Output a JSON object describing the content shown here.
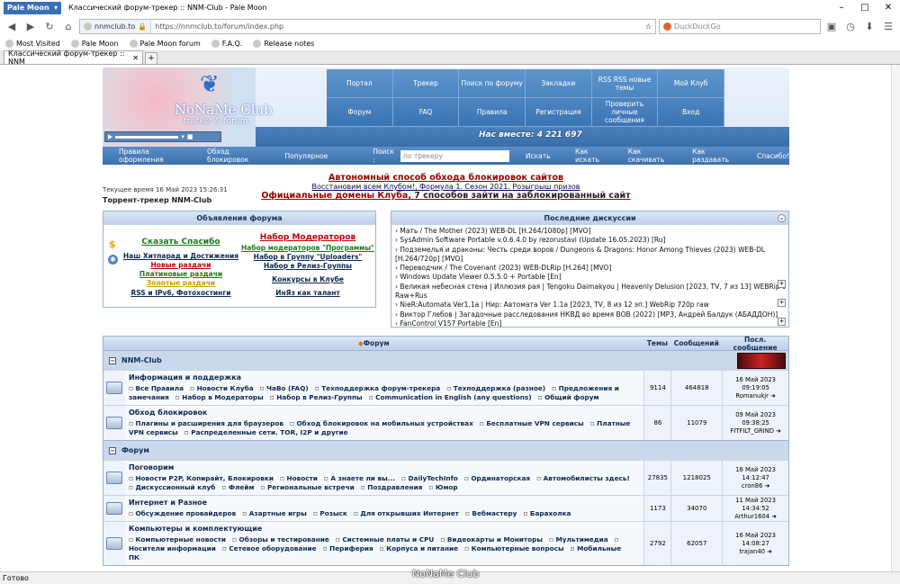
{
  "browser": {
    "app_button": "Pale Moon",
    "window_title": "Классический форум-трекер :: NNM-Club - Pale Moon",
    "url_host": "nnmclub.to",
    "url_full": "https://nnmclub.to/forum/index.php",
    "search_placeholder": "DuckDuckGo",
    "bookmarks": [
      "Most Visited",
      "Pale Moon",
      "Pale Moon forum",
      "F.A.Q.",
      "Release notes"
    ],
    "tab_title": "Классический форум-трекер :: NNM",
    "status": "Готово"
  },
  "header": {
    "logo_text": "NoNaMe Club",
    "logo_sub": "tracker & forum",
    "menu": [
      "Портал",
      "Трекер",
      "Поиск по форуму",
      "Закладки",
      "RSS RSS новые темы",
      "Мой Клуб",
      "Форум",
      "FAQ",
      "Правила",
      "Регистрация",
      "Проверить личные сообщения",
      "Вход"
    ],
    "online": "Нас вместе: 4 221 697",
    "subnav": [
      "Правила оформления",
      "Обход блокировок",
      "Популярное"
    ],
    "search_label": "Поиск :",
    "search_placeholder": "по трекеру",
    "search_button": "Искать",
    "subnav_right": [
      "Как искать",
      "Как скачивать",
      "Как раздавать",
      "Спасибо!"
    ]
  },
  "announcements": {
    "line1": "Автономный способ обхода блокировок сайтов",
    "line2a": "Восстановим всем Клубом!",
    "line2b": "Формула 1. Сезон 2021. Розыгрыш призов",
    "line3a": "Официальные домены Клуба",
    "line3b": "7 способов зайти на заблокированный сайт",
    "current_time": "Текущее время 16 Май 2023 15:26:31",
    "tracker_label": "Торрент-трекер NNM-Club"
  },
  "forum_ann": {
    "title": "Объявления форума",
    "col1": [
      {
        "text": "Сказать Спасибо",
        "color": "#1a7a1a"
      },
      {
        "text": "Наш Хитпарад и Достижения",
        "color": "#0d2750"
      },
      {
        "text": "Новые раздачи",
        "color": "#c00000"
      },
      {
        "text": "Платиновые раздачи",
        "color": "#1a7a1a"
      },
      {
        "text": "Золотые раздачи",
        "color": "#c99a00"
      },
      {
        "text": "RSS и IPv6, Фотохостинги",
        "color": "#0d2750"
      }
    ],
    "col2": [
      {
        "text": "Набор Модераторов",
        "color": "#c00000"
      },
      {
        "text": "Набор модераторов \"Программы\"",
        "color": "#1a7a1a"
      },
      {
        "text": "Набор в Группу \"Uploaders\"",
        "color": "#0d2750"
      },
      {
        "text": "Набор в Релиз-Группы",
        "color": "#0d2750"
      },
      {
        "text": "Конкурсы в Клубе",
        "color": "#0d2750"
      },
      {
        "text": "ИнЯз как талант",
        "color": "#0d2750"
      }
    ]
  },
  "discussions": {
    "title": "Последние дискуссии",
    "items": [
      "Мать / The Mother (2023) WEB-DL [H.264/1080p] [MVO]",
      "SysAdmin Software Portable v.0.6.4.0 by rezorustavi (Update 16.05.2023) [Ru]",
      "Подземелья и драконы: Честь среди воров / Dungeons & Dragons: Honor Among Thieves (2023) WEB-DL",
      "[H.264/720p] [MVO]",
      "Переводчик / The Covenant (2023) WEB-DLRip [H.264] [MVO]",
      "Windows Update Viewer 0.5.5.0 + Portable [En]",
      "Великая небесная стена | Иллюзия рая | Tengoku Daimakyou | Heavenly Delusion [2023, TV, 7 из 13] WEBRip 1080p",
      "Raw+Rus",
      "NieR:Automata Ver1.1a | Нир: Автомата Ver 1.1a [2023, TV, 8 из 12 эп.] WebRip 720p raw",
      "Виктор Глебов | Загадочные расследования НКВД во время ВОВ (2022) [MP3, Андрей Балдук (АБАДДОН)]",
      "FanControl V157 Portable [En]"
    ]
  },
  "table": {
    "head": [
      "Форум",
      "Темы",
      "Сообщений",
      "Посл. сообщение"
    ],
    "categories": [
      {
        "name": "NNM-Club",
        "forums": [
          {
            "name": "Информация и поддержка",
            "subs": "Все Правила|Новости Клуба|ЧаВо (FAQ)|Техподдержка форум-трекера|Техподдержка (разное)|Предложения и замечания|Набор в Модераторы|Набор в Релиз-Группы|Communication in English (any questions)|Общий форум",
            "topics": "9114",
            "posts": "464818",
            "last_date": "16 Май 2023 09:19:05",
            "last_user": "Romanukjr"
          },
          {
            "name": "Обход блокировок",
            "subs": "Плагины и расширения для браузеров|Обход блокировок на мобильных устройствах|Бесплатные VPN сервисы|Платные VPN сервисы|Распределенные сети. TOR, I2P и другие",
            "topics": "86",
            "posts": "11079",
            "last_date": "09 Май 2023 09:38:25",
            "last_user": "FITFILT_GRIND"
          }
        ]
      },
      {
        "name": "Форум",
        "forums": [
          {
            "name": "Поговорим",
            "subs": "Новости P2P, Копирайт, Блокировки|Новости|А знаете ли вы...|DailyTechInfo|Ординаторская|Автомобилисты здесь!|Дискуссионный клуб|Флейм|Региональные встречи|Поздравления|Юмор",
            "topics": "27835",
            "posts": "1218025",
            "last_date": "16 Май 2023 14:12:47",
            "last_user": "cron86"
          },
          {
            "name": "Интернет и Разное",
            "subs": "Обсуждение провайдеров|Азартные игры|Розыск|Для открывших Интернет|Вебмастеру|Барахолка",
            "topics": "1173",
            "posts": "34070",
            "last_date": "11 Май 2023 14:34:52",
            "last_user": "Arthur1604"
          },
          {
            "name": "Компьютеры и комплектующие",
            "subs": "Компьютерные новости|Обзоры и тестирование|Системные платы и CPU|Видеокарты и Мониторы|Мультимедиа|Носители информации|Сетевое оборудование|Периферия|Корпуса и питание|Компьютерные вопросы|Мобильные ПК",
            "topics": "2792",
            "posts": "62057",
            "last_date": "16 Май 2023 14:08:27",
            "last_user": "trajan40"
          }
        ]
      }
    ]
  },
  "watermark": "NoNaMe Club",
  "colors": {
    "accent": "#3b74b3",
    "header_bg": "#dbe7f5",
    "table_head": "#bcd0e8",
    "category_row": "#c9d8ea"
  }
}
